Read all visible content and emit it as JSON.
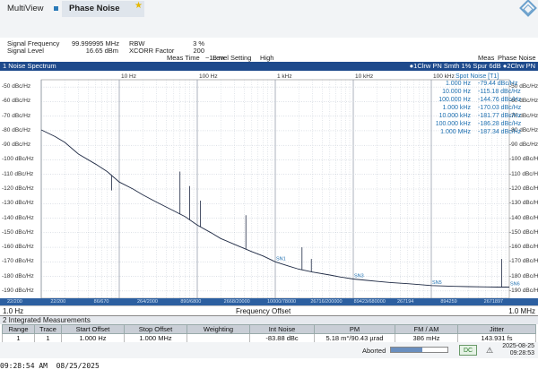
{
  "tabs": {
    "multiview": "MultiView",
    "phase_noise": "Phase Noise"
  },
  "params_left": [
    {
      "label": "Signal Frequency",
      "value": "99.999995 MHz"
    },
    {
      "label": "Signal Level",
      "value": "16.65 dBm"
    }
  ],
  "params_mid": [
    {
      "label": "RBW",
      "value": "3 %"
    },
    {
      "label": "XCORR Factor",
      "value": "200"
    },
    {
      "label": "Meas Time",
      "value": "~18 m"
    }
  ],
  "level_setting": {
    "label": "Level Setting",
    "value": "High"
  },
  "meas_mode": {
    "label": "Meas",
    "value": "Phase Noise"
  },
  "window": {
    "title": "1 Noise Spectrum",
    "traces": "●1Clrw PN Smth 1% Spur 6dB ●2Clrw PN"
  },
  "top_decades": [
    "10 Hz",
    "100 Hz",
    "1 kHz",
    "10 kHz",
    "100 kHz"
  ],
  "y_axis_labels": [
    "-50 dBc/Hz",
    "-60 dBc/Hz",
    "-70 dBc/Hz",
    "-80 dBc/Hz",
    "-90 dBc/Hz",
    "-100 dBc/Hz",
    "-110 dBc/Hz",
    "-120 dBc/Hz",
    "-130 dBc/Hz",
    "-140 dBc/Hz",
    "-150 dBc/Hz",
    "-160 dBc/Hz",
    "-170 dBc/Hz",
    "-180 dBc/Hz",
    "-190 dBc/Hz"
  ],
  "spot_noise": {
    "title": "Spot Noise [T1]",
    "rows": [
      {
        "freq": "1.000 Hz",
        "value": "-79.44 dBc/Hz"
      },
      {
        "freq": "10.000 Hz",
        "value": "-115.18 dBc/Hz"
      },
      {
        "freq": "100.000 Hz",
        "value": "-144.76 dBc/Hz"
      },
      {
        "freq": "1.000 kHz",
        "value": "-170.03 dBc/Hz"
      },
      {
        "freq": "10.000 kHz",
        "value": "-181.77 dBc/Hz"
      },
      {
        "freq": "100.000 kHz",
        "value": "-186.28 dBc/Hz"
      },
      {
        "freq": "1.000 MHz",
        "value": "-187.34 dBc/Hz"
      }
    ]
  },
  "spot_markers": [
    "SN1",
    "SN3",
    "SN5",
    "SN6"
  ],
  "bottom_ticks": [
    "22/200",
    "22/200",
    "86/670",
    "264/2000",
    "890/6800",
    "2668/20000",
    "10000/78000",
    "26716/200000",
    "89423/680000",
    "267194",
    "894259",
    "2671897"
  ],
  "x_axis": {
    "start": "1.0 Hz",
    "label": "Frequency Offset",
    "stop": "1.0 MHz"
  },
  "integrated": {
    "title": "2 Integrated Measurements",
    "headers": [
      "Range",
      "Trace",
      "Start Offset",
      "Stop Offset",
      "Weighting",
      "Int Noise",
      "PM",
      "FM / AM",
      "Jitter"
    ],
    "row": [
      "1",
      "1",
      "1.000 Hz",
      "1.000 MHz",
      "",
      "-83.88 dBc",
      "5.18 m°/90.43 µrad",
      "386 mHz",
      "143.931 fs"
    ]
  },
  "status": {
    "aborted": "Aborted",
    "progress": 0.55,
    "dc_label": "DC",
    "date": "2025-08-25",
    "time": "09:28:53"
  },
  "footer": "09:28:54 AM  08/25/2025",
  "chart_data": {
    "type": "line",
    "x_scale": "log",
    "x_unit": "Hz",
    "xlim": [
      1,
      1000000
    ],
    "ylim": [
      -195,
      -45
    ],
    "ylabel": "dBc/Hz",
    "xlabel": "Frequency Offset",
    "series": [
      {
        "name": "1Clrw PN Smth 1% Spur 6dB",
        "color": "#1f2a44",
        "x": [
          1,
          1.5,
          2,
          3,
          5,
          7,
          10,
          15,
          20,
          30,
          50,
          70,
          100,
          150,
          200,
          300,
          500,
          700,
          1000,
          1500,
          2000,
          3000,
          5000,
          7000,
          10000,
          15000,
          20000,
          30000,
          50000,
          70000,
          100000,
          150000,
          200000,
          300000,
          500000,
          700000,
          1000000
        ],
        "y": [
          -79.4,
          -84,
          -88,
          -96,
          -103,
          -108,
          -115.2,
          -120,
          -124,
          -129,
          -135,
          -139,
          -144.8,
          -150,
          -154,
          -158,
          -163,
          -166,
          -170,
          -173,
          -175,
          -177,
          -179,
          -180.5,
          -181.8,
          -182.7,
          -183.4,
          -184.2,
          -185,
          -185.6,
          -186.3,
          -186.6,
          -186.8,
          -187,
          -187.2,
          -187.3,
          -187.3
        ]
      }
    ],
    "spurs": [
      {
        "x": 8,
        "y": -121
      },
      {
        "x": 60,
        "y": -108
      },
      {
        "x": 80,
        "y": -118
      },
      {
        "x": 110,
        "y": -128
      },
      {
        "x": 420,
        "y": -138
      },
      {
        "x": 2200,
        "y": -160
      },
      {
        "x": 2900,
        "y": -168
      },
      {
        "x": 800000,
        "y": -168
      }
    ],
    "spot_markers_x": [
      1000,
      10000,
      100000,
      1000000
    ],
    "colors": {
      "trace": "#1f2a44",
      "grid": "#b8c0cc",
      "grid_decade": "#8892a0",
      "spot": "#1d6fb0"
    }
  }
}
